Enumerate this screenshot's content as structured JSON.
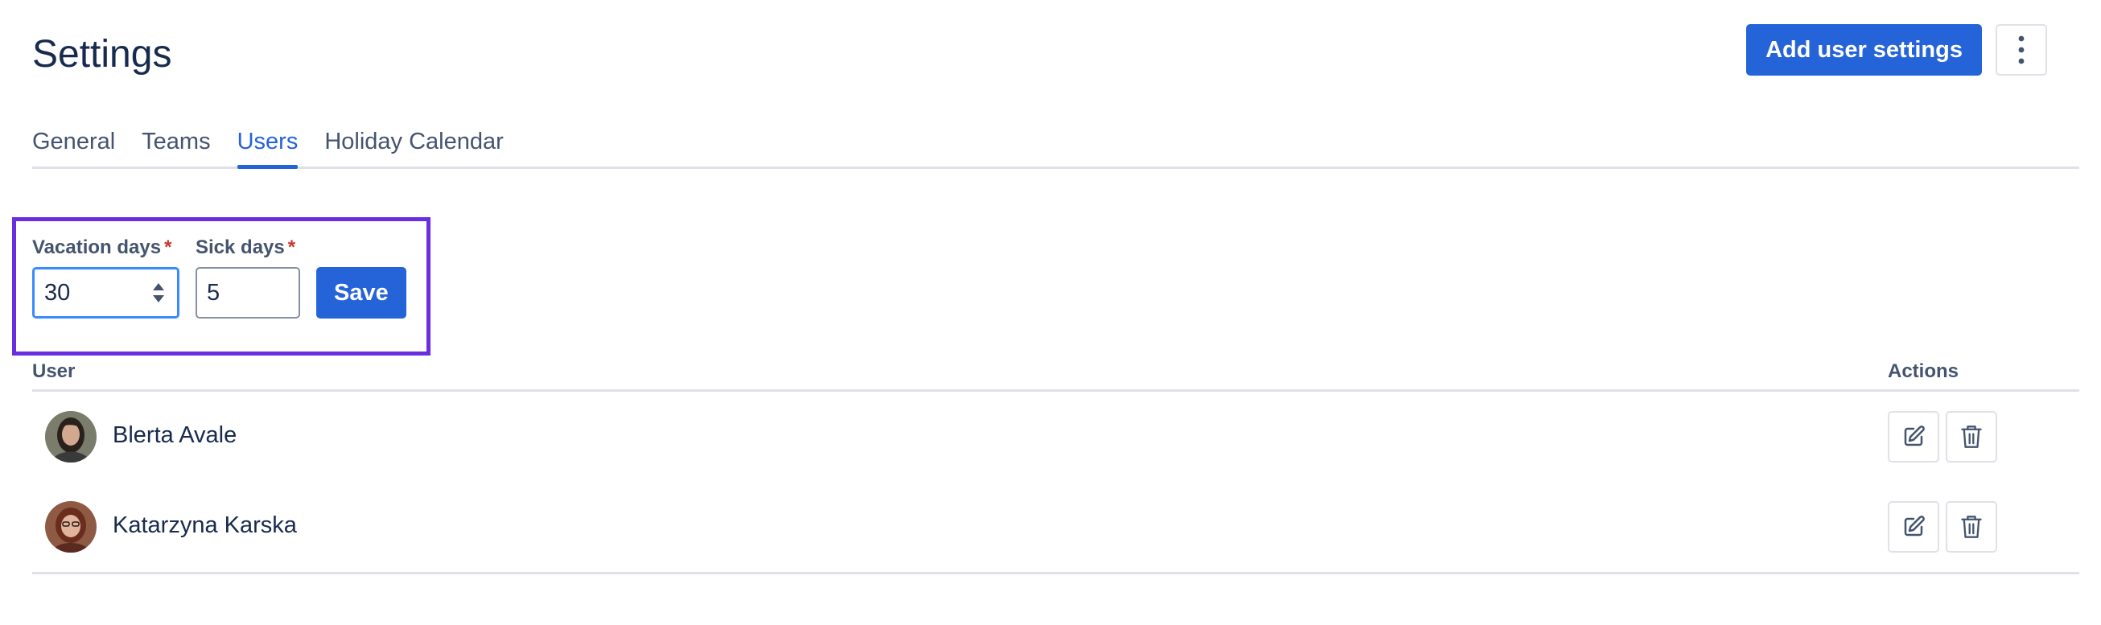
{
  "header": {
    "title": "Settings",
    "add_button_label": "Add user settings",
    "more_icon": "more-vertical-icon"
  },
  "tabs": [
    {
      "label": "General",
      "active": false
    },
    {
      "label": "Teams",
      "active": false
    },
    {
      "label": "Users",
      "active": true
    },
    {
      "label": "Holiday Calendar",
      "active": false
    }
  ],
  "form": {
    "vacation_label": "Vacation days",
    "vacation_value": "30",
    "sick_label": "Sick days",
    "sick_value": "5",
    "required_marker": "*",
    "save_label": "Save"
  },
  "table": {
    "columns": {
      "user": "User",
      "actions": "Actions"
    },
    "rows": [
      {
        "name": "Blerta Avale",
        "avatar": "avatar-blerta"
      },
      {
        "name": "Katarzyna Karska",
        "avatar": "avatar-katarzyna"
      }
    ],
    "action_icons": [
      "edit-icon",
      "trash-icon"
    ]
  },
  "colors": {
    "primary": "#2563d9",
    "highlight": "#6a2ee0",
    "required": "#c9372c",
    "border": "#dfe1e6"
  }
}
